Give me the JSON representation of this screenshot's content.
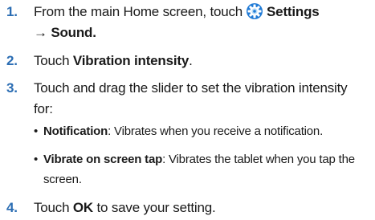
{
  "steps": [
    {
      "number": "1.",
      "before_icon": "From the main Home screen, touch",
      "icon": "settings-gear-icon",
      "after_icon": "Settings",
      "line2": "→ Sound."
    },
    {
      "number": "2.",
      "text": "Touch",
      "bold": "Vibration intensity",
      "end": "."
    },
    {
      "number": "3.",
      "line1": "Touch and drag the slider to set the vibration intensity",
      "line2": "for:",
      "bullets": [
        {
          "dot": "•",
          "bold": "Notification",
          "text": ": Vibrates when you receive a notification."
        },
        {
          "dot": "•",
          "bold": "Vibrate on screen tap",
          "text": ": Vibrates the tablet when you tap the",
          "continuation": "screen."
        }
      ]
    },
    {
      "number": "4.",
      "text": "Touch",
      "bold": "OK",
      "end": " to save your setting."
    }
  ],
  "colors": {
    "step_number": "#2b6db3",
    "gear_outer": "#1f7ad6",
    "gear_inner": "#b9dcf7"
  }
}
